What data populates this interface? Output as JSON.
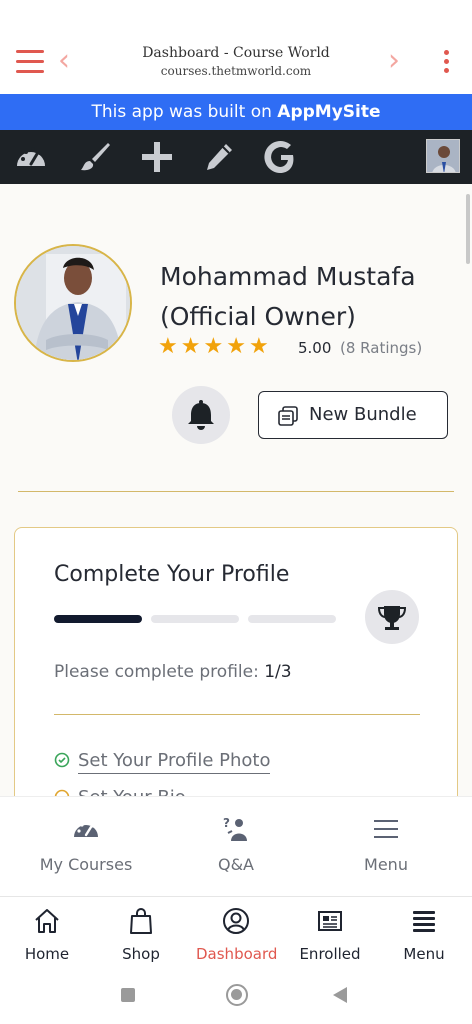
{
  "header": {
    "title": "Dashboard - Course World",
    "subtitle": "courses.thetmworld.com"
  },
  "banner": {
    "prefix": "This app was built on ",
    "brand": "AppMySite"
  },
  "profile": {
    "name_line1": "Mohammad Mustafa",
    "name_line2": "(Official Owner)",
    "stars": 5,
    "rating_value": "5.00",
    "rating_count": "(8 Ratings)",
    "new_bundle_label": "New Bundle"
  },
  "complete_profile": {
    "title": "Complete Your Profile",
    "progress_label": "Please complete profile: ",
    "progress_value": "1/3",
    "steps_done": 1,
    "steps_total": 3,
    "tasks": [
      {
        "label": "Set Your Profile Photo"
      },
      {
        "label": "Set Your Bio"
      }
    ]
  },
  "plugin_tabs": [
    {
      "label": "My Courses",
      "icon": "dashboard-gauge-icon"
    },
    {
      "label": "Q&A",
      "icon": "question-person-icon"
    },
    {
      "label": "Menu",
      "icon": "hamburger-menu-icon"
    }
  ],
  "app_tabs": [
    {
      "label": "Home",
      "icon": "home-icon"
    },
    {
      "label": "Shop",
      "icon": "shopping-bag-icon"
    },
    {
      "label": "Dashboard",
      "icon": "user-circle-icon",
      "active": true
    },
    {
      "label": "Enrolled",
      "icon": "newspaper-icon"
    },
    {
      "label": "Menu",
      "icon": "list-icon"
    }
  ],
  "colors": {
    "accent": "#e0584f",
    "banner": "#2f6df4",
    "toolbar": "#1d2226",
    "star": "#f1a20b",
    "gold": "#d3b86a"
  }
}
